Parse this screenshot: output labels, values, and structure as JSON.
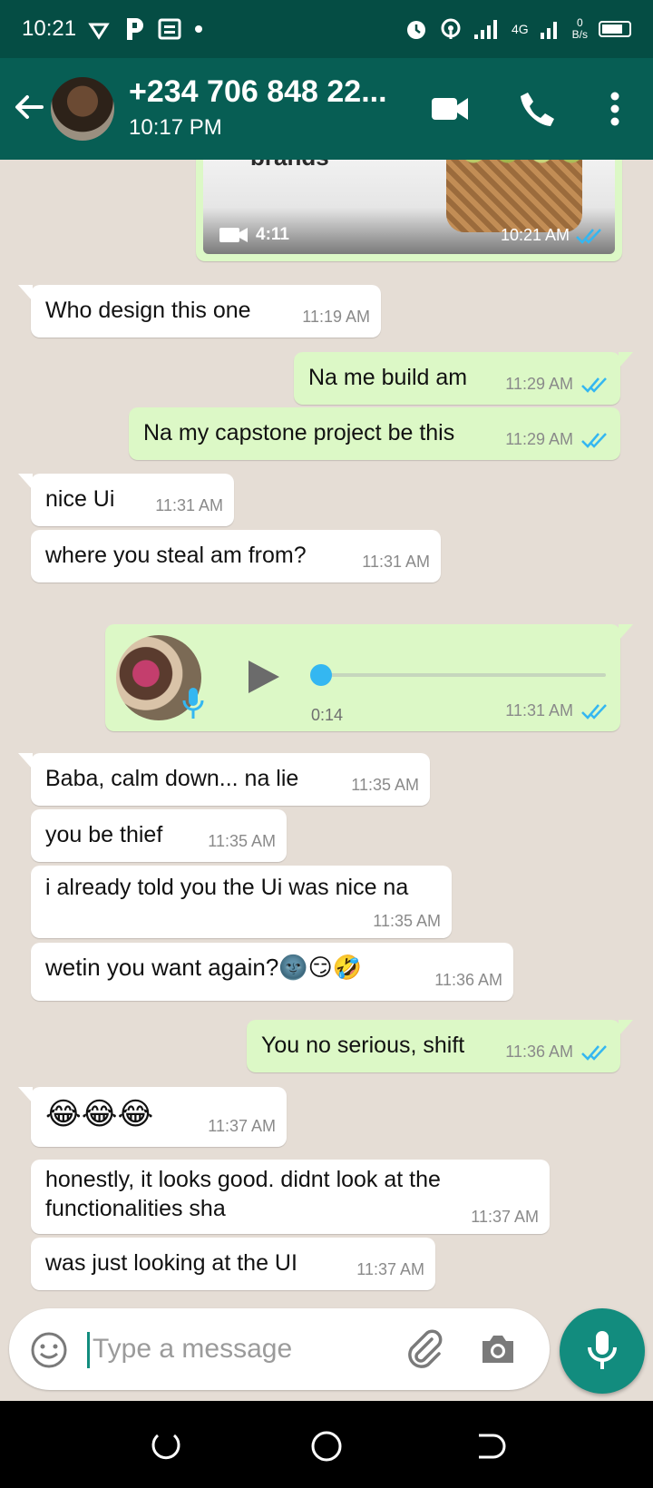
{
  "status_bar": {
    "time": "10:21",
    "network": "4G",
    "data_rate_value": "0",
    "data_rate_unit": "B/s"
  },
  "header": {
    "contact": "+234 706 848 22...",
    "last_seen": "10:17 PM"
  },
  "messages": [
    {
      "type": "video",
      "direction": "out",
      "thumb_text": "brands",
      "duration": "4:11",
      "time": "10:21 AM"
    },
    {
      "type": "text",
      "direction": "in",
      "text": "Who design this one",
      "time": "11:19 AM"
    },
    {
      "type": "text",
      "direction": "out",
      "text": "Na me build am",
      "time": "11:29 AM"
    },
    {
      "type": "text",
      "direction": "out",
      "text": "Na my capstone project be this",
      "time": "11:29 AM"
    },
    {
      "type": "text",
      "direction": "in",
      "text": "nice Ui",
      "time": "11:31 AM"
    },
    {
      "type": "text",
      "direction": "in",
      "text": "where you steal am from?",
      "time": "11:31 AM"
    },
    {
      "type": "voice",
      "direction": "out",
      "duration": "0:14",
      "time": "11:31 AM",
      "progress": 0
    },
    {
      "type": "text",
      "direction": "in",
      "text": "Baba, calm down... na lie",
      "time": "11:35 AM"
    },
    {
      "type": "text",
      "direction": "in",
      "text": "you be thief",
      "time": "11:35 AM"
    },
    {
      "type": "text",
      "direction": "in",
      "text": "i already told you the Ui was nice na",
      "time": "11:35 AM"
    },
    {
      "type": "text",
      "direction": "in",
      "text": "wetin you want again?🌚😏🤣",
      "time": "11:36 AM"
    },
    {
      "type": "text",
      "direction": "out",
      "text": "You no serious, shift",
      "time": "11:36 AM"
    },
    {
      "type": "text",
      "direction": "in",
      "text": "😂😂😂",
      "time": "11:37 AM"
    },
    {
      "type": "text",
      "direction": "in",
      "text_line1": "honestly, it looks good. didnt look at the",
      "text_line2": "functionalities sha",
      "time": "11:37 AM"
    },
    {
      "type": "text",
      "direction": "in",
      "text": "was just looking at the UI",
      "time": "11:37 AM"
    }
  ],
  "composer": {
    "placeholder": "Type a message"
  },
  "colors": {
    "header": "#075e54",
    "status_bar": "#054d44",
    "outgoing": "#dcf8c6",
    "incoming": "#ffffff",
    "read_ticks": "#34b7f1",
    "accent": "#128c7e",
    "background": "#e5ddd5"
  },
  "icons": [
    "back-arrow-icon",
    "video-call-icon",
    "phone-icon",
    "more-options-icon",
    "video-camera-icon",
    "double-check-icon",
    "play-icon",
    "microphone-icon",
    "emoji-icon",
    "attach-icon",
    "camera-icon",
    "recent-apps-icon",
    "home-icon",
    "back-nav-icon"
  ]
}
